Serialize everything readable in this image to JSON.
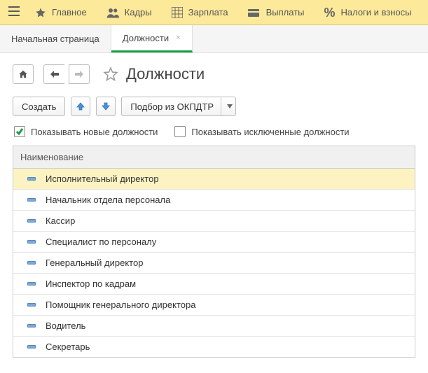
{
  "topbar": {
    "items": [
      {
        "label": "Главное",
        "icon": "star"
      },
      {
        "label": "Кадры",
        "icon": "people"
      },
      {
        "label": "Зарплата",
        "icon": "grid"
      },
      {
        "label": "Выплаты",
        "icon": "wallet"
      },
      {
        "label": "Налоги и взносы",
        "icon": "percent"
      }
    ]
  },
  "tabs": {
    "items": [
      {
        "label": "Начальная страница",
        "active": false,
        "closable": false
      },
      {
        "label": "Должности",
        "active": true,
        "closable": true
      }
    ]
  },
  "page": {
    "title": "Должности"
  },
  "toolbar": {
    "create_label": "Создать",
    "okpdtr_label": "Подбор из ОКПДТР"
  },
  "filters": {
    "show_new": {
      "label": "Показывать новые должности",
      "checked": true
    },
    "show_excluded": {
      "label": "Показывать исключенные должности",
      "checked": false
    }
  },
  "table": {
    "header": "Наименование",
    "rows": [
      {
        "name": "Исполнительный директор",
        "selected": true
      },
      {
        "name": "Начальник отдела персонала",
        "selected": false
      },
      {
        "name": "Кассир",
        "selected": false
      },
      {
        "name": "Специалист по персоналу",
        "selected": false
      },
      {
        "name": "Генеральный директор",
        "selected": false
      },
      {
        "name": "Инспектор по кадрам",
        "selected": false
      },
      {
        "name": "Помощник генерального директора",
        "selected": false
      },
      {
        "name": "Водитель",
        "selected": false
      },
      {
        "name": "Секретарь",
        "selected": false
      }
    ]
  }
}
